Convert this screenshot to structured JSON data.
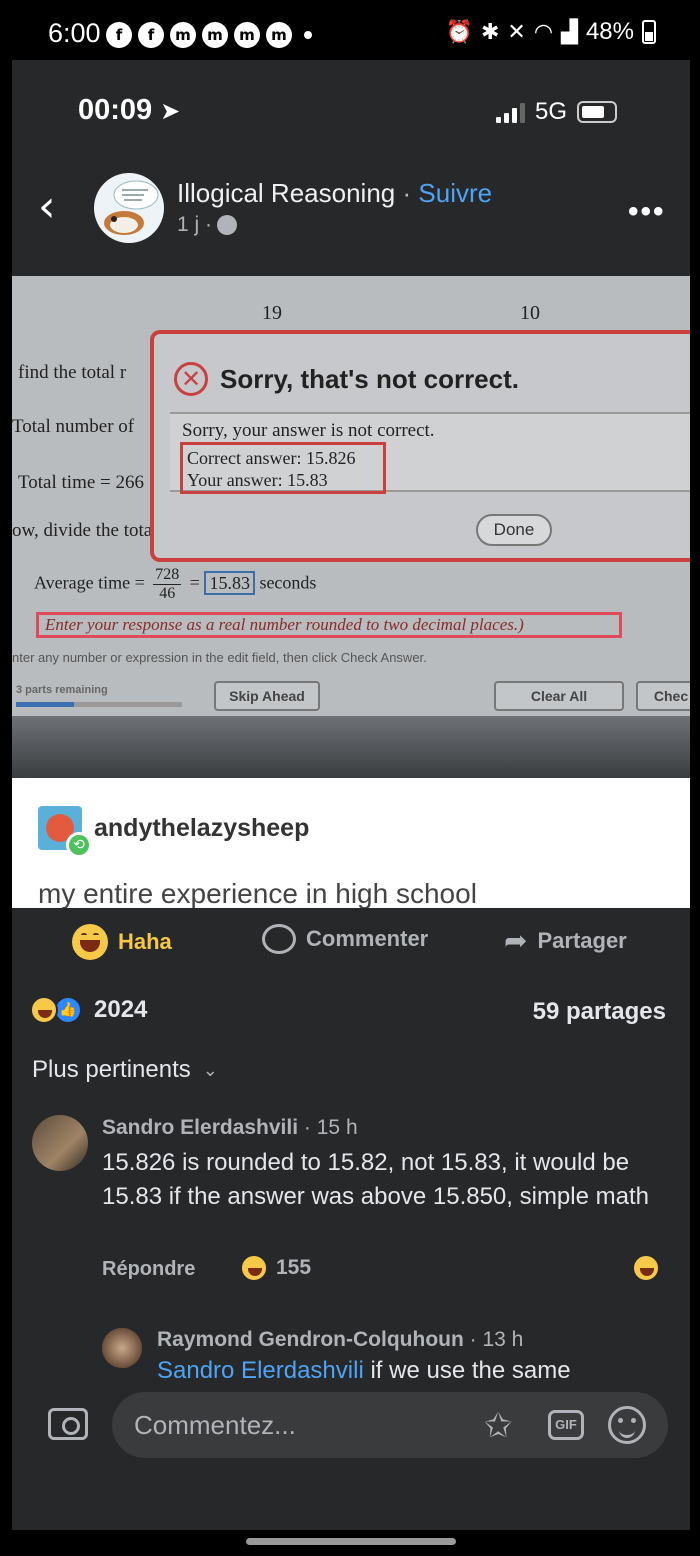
{
  "android_status": {
    "time": "6:00",
    "notification_icons": [
      "f",
      "f",
      "m",
      "m",
      "m",
      "m"
    ],
    "battery": "48%"
  },
  "ios_status": {
    "time": "00:09",
    "network": "5G"
  },
  "post": {
    "page_name": "Illogical Reasoning",
    "separator": "·",
    "follow": "Suivre",
    "age": "1 j ·",
    "more": "•••"
  },
  "photo": {
    "tick_top_left": "19",
    "tick_top_right": "10",
    "left_lines": [
      "find the total r",
      "Total number of",
      "Total time = 266",
      "ow, divide the tota"
    ],
    "dialog_title": "Sorry, that's not correct.",
    "dialog_message": "Sorry, your answer is not correct.",
    "correct_answer": "Correct answer: 15.826",
    "your_answer": "Your answer: 15.83",
    "done_button": "Done",
    "avg_label": "Average time =",
    "avg_numerator": "728",
    "avg_denominator": "46",
    "avg_equals": "=",
    "avg_value": "15.83",
    "avg_unit": "seconds",
    "instruction": "Enter your response as a real number rounded to two decimal places.)",
    "enter_any": "nter any number or expression in the edit field, then click Check Answer.",
    "parts_remaining": "3 parts remaining",
    "progress": 0.35,
    "skip_button": "Skip Ahead",
    "clear_button": "Clear All",
    "check_button": "Chec"
  },
  "tumblr": {
    "username": "andythelazysheep",
    "caption": "my entire experience in high school"
  },
  "actions": {
    "haha": "Haha",
    "comment": "Commenter",
    "share": "Partager"
  },
  "stats": {
    "reactions": "2024",
    "shares": "59 partages"
  },
  "sort": {
    "label": "Plus pertinents"
  },
  "comments": [
    {
      "author": "Sandro Elerdashvili",
      "time": "· 15 h",
      "text": "15.826 is rounded to 15.82, not 15.83, it would be 15.83 if the answer was above 15.850, simple math",
      "reply": "Répondre",
      "reactions": "155"
    },
    {
      "author": "Raymond Gendron-Colquhoun",
      "time": "· 13 h",
      "mention": "Sandro Elerdashvili",
      "text": " if we use the same"
    }
  ],
  "composer": {
    "placeholder": "Commentez...",
    "gif": "GIF"
  }
}
